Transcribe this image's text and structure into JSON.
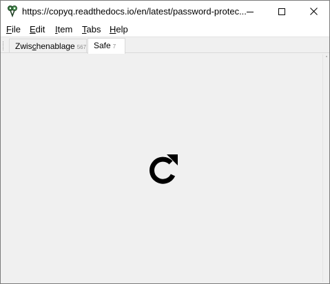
{
  "window": {
    "title": "https://copyq.readthedocs.io/en/latest/password-protec...",
    "icon": "copyq-app-icon",
    "controls": [
      "minimize-icon",
      "maximize-icon",
      "close-icon"
    ]
  },
  "menu": {
    "items": [
      {
        "mnemonic": "F",
        "rest": "ile"
      },
      {
        "mnemonic": "E",
        "rest": "dit"
      },
      {
        "mnemonic": "I",
        "rest": "tem"
      },
      {
        "mnemonic": "T",
        "rest": "abs"
      },
      {
        "mnemonic": "H",
        "rest": "elp"
      }
    ]
  },
  "tabs": [
    {
      "pre": "Zwis",
      "mnemonic": "c",
      "post": "henablage",
      "count": "567",
      "active": false
    },
    {
      "pre": "Safe",
      "mnemonic": "",
      "post": "",
      "count": "7",
      "active": true
    }
  ],
  "content": {
    "icon": "reload-icon"
  },
  "colors": {
    "background": "#f0f0f0",
    "titlebar": "#ffffff",
    "icon": "#000000"
  }
}
